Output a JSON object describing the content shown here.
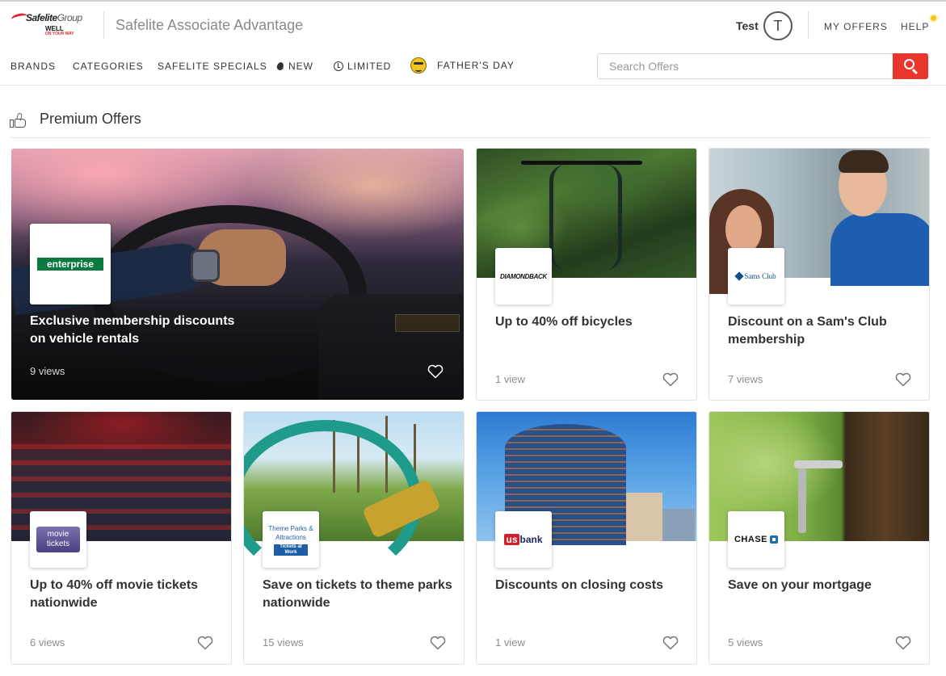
{
  "header": {
    "logo_brand": "Safelite",
    "logo_group": "Group",
    "logo_tag": "WELL",
    "logo_tag_sub": "ON YOUR WAY",
    "site_title": "Safelite Associate Advantage",
    "user_name": "Test",
    "avatar_initial": "T",
    "my_offers": "MY OFFERS",
    "help": "HELP"
  },
  "nav": {
    "items": [
      {
        "label": "BRANDS",
        "icon": ""
      },
      {
        "label": "CATEGORIES",
        "icon": ""
      },
      {
        "label": "SAFELITE SPECIALS",
        "icon": ""
      },
      {
        "label": "NEW",
        "icon": "flame-icon"
      },
      {
        "label": "LIMITED",
        "icon": "clock-icon"
      },
      {
        "label": "FATHER'S DAY",
        "icon": "face-icon"
      }
    ],
    "search_placeholder": "Search Offers",
    "search_value": ""
  },
  "section": {
    "title": "Premium Offers"
  },
  "colors": {
    "accent_red": "#e8362d",
    "help_dot": "#f5c518",
    "enterprise_green": "#0a7a3e",
    "usbank_blue": "#1a2a66",
    "chase_blue": "#1a6bb8"
  },
  "offers": [
    {
      "brand": "enterprise",
      "title": "Exclusive membership discounts on vehicle rentals",
      "views": "9 views"
    },
    {
      "brand": "DIAMONDBACK",
      "title": "Up to 40% off bicycles",
      "views": "1 view"
    },
    {
      "brand": "Sams Club",
      "title": "Discount on a Sam's Club membership",
      "views": "7 views"
    },
    {
      "brand": "movie tickets",
      "title": "Up to 40% off movie tickets nationwide",
      "views": "6 views"
    },
    {
      "brand": "Theme Parks & Attractions",
      "brand_sub": "Tickets at Work",
      "title": "Save on tickets to theme parks nationwide",
      "views": "15 views"
    },
    {
      "brand": "bank",
      "brand_prefix": "us",
      "title": "Discounts on closing costs",
      "views": "1 view"
    },
    {
      "brand": "CHASE",
      "title": "Save on your mortgage",
      "views": "5 views"
    }
  ]
}
